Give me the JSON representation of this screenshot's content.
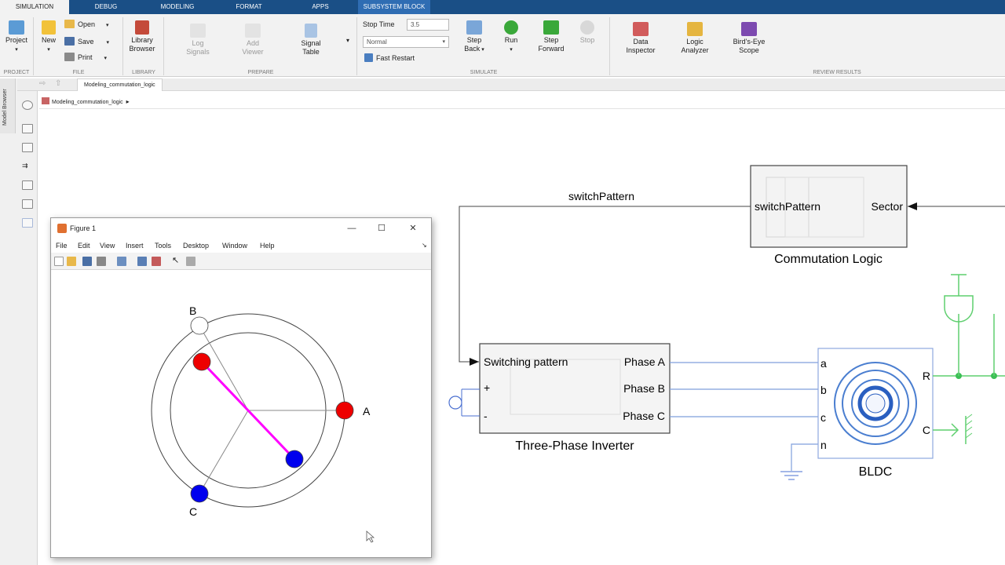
{
  "tabs": [
    "SIMULATION",
    "DEBUG",
    "MODELING",
    "FORMAT",
    "APPS",
    "SUBSYSTEM BLOCK"
  ],
  "toolstrip": {
    "project": {
      "label": "Project"
    },
    "new": {
      "label": "New"
    },
    "open": {
      "label": "Open"
    },
    "save": {
      "label": "Save"
    },
    "print": {
      "label": "Print"
    },
    "library": {
      "label1": "Library",
      "label2": "Browser"
    },
    "log_signals": {
      "label1": "Log",
      "label2": "Signals"
    },
    "add_viewer": {
      "label1": "Add",
      "label2": "Viewer"
    },
    "signal_table": {
      "label1": "Signal",
      "label2": "Table"
    },
    "stop_time_label": "Stop Time",
    "stop_time_value": "3.5",
    "sim_mode": "Normal",
    "fast_restart": "Fast Restart",
    "step_back": {
      "label1": "Step",
      "label2": "Back"
    },
    "run": {
      "label": "Run"
    },
    "step_forward": {
      "label1": "Step",
      "label2": "Forward"
    },
    "stop": {
      "label": "Stop"
    },
    "data_inspector": {
      "label1": "Data",
      "label2": "Inspector"
    },
    "logic_analyzer": {
      "label1": "Logic",
      "label2": "Analyzer"
    },
    "birds_eye": {
      "label1": "Bird's-Eye",
      "label2": "Scope"
    },
    "groups": [
      "PROJECT",
      "FILE",
      "LIBRARY",
      "PREPARE",
      "SIMULATE",
      "REVIEW RESULTS"
    ]
  },
  "nav": {
    "tab_name": "Modeling_commutation_logic"
  },
  "breadcrumb": {
    "model": "Modeling_commutation_logic"
  },
  "palette": {
    "side_label": "Model Browser"
  },
  "diagram": {
    "signal_label": "switchPattern",
    "commutation": {
      "in_port": "switchPattern",
      "out_port": "Sector",
      "name": "Commutation Logic"
    },
    "inverter": {
      "port_switch": "Switching pattern",
      "port_plus": "+",
      "port_minus": "-",
      "port_a": "Phase A",
      "port_b": "Phase B",
      "port_c": "Phase C",
      "name": "Three-Phase Inverter"
    },
    "bldc": {
      "port_a": "a",
      "port_b": "b",
      "port_c": "c",
      "port_n": "n",
      "port_r": "R",
      "port_c_out": "C",
      "name": "BLDC"
    }
  },
  "figure": {
    "title": "Figure 1",
    "menu": [
      "File",
      "Edit",
      "View",
      "Insert",
      "Tools",
      "Desktop",
      "Window",
      "Help"
    ],
    "labels": {
      "a": "A",
      "b": "B",
      "c": "C"
    },
    "colors": {
      "red": "#ee0000",
      "blue": "#0000ee",
      "magenta": "#ff00ff",
      "white": "#ffffff"
    }
  }
}
